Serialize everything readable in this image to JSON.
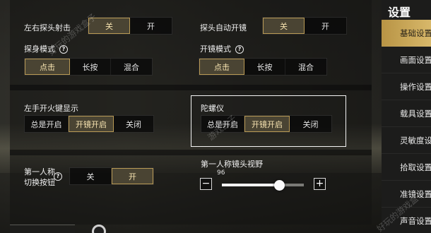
{
  "nav": {
    "title": "设置",
    "items": [
      {
        "label": "基础设置",
        "active": true
      },
      {
        "label": "画面设置",
        "active": false
      },
      {
        "label": "操作设置",
        "active": false
      },
      {
        "label": "载具设置",
        "active": false
      },
      {
        "label": "灵敏度设置",
        "active": false
      },
      {
        "label": "拾取设置",
        "active": false
      },
      {
        "label": "准镜设置",
        "active": false
      },
      {
        "label": "声音设置",
        "active": false
      }
    ]
  },
  "settings": {
    "lean_fire": {
      "label": "左右探头射击",
      "options": [
        "关",
        "开"
      ],
      "selected": "关"
    },
    "auto_scope_peek": {
      "label": "探头自动开镜",
      "options": [
        "关",
        "开"
      ],
      "selected": "关"
    },
    "peek_mode": {
      "label": "探身模式",
      "options": [
        "点击",
        "长按",
        "混合"
      ],
      "selected": "点击"
    },
    "scope_mode": {
      "label": "开镜模式",
      "options": [
        "点击",
        "长按",
        "混合"
      ],
      "selected": "点击"
    },
    "left_fire": {
      "label": "左手开火键显示",
      "options": [
        "总是开启",
        "开镜开启",
        "关闭"
      ],
      "selected": "开镜开启"
    },
    "gyro": {
      "label": "陀螺仪",
      "options": [
        "总是开启",
        "开镜开启",
        "关闭"
      ],
      "selected": "开镜开启"
    },
    "fpp_switch": {
      "label_line1": "第一人称",
      "label_line2": "切换按钮",
      "options": [
        "关",
        "开"
      ],
      "selected": "开"
    },
    "fpp_fov": {
      "label": "第一人称镜头视野",
      "value": "96",
      "fraction": 0.7,
      "minus": "−",
      "plus": "+"
    }
  },
  "watermarks": [
    "好玩的游戏盒子",
    "游戏盒子",
    "好玩的游戏盒子"
  ],
  "colors": {
    "accent_gold": "#b99a55",
    "nav_active": "#d8b86a",
    "selected_text": "#f7e3b0"
  }
}
